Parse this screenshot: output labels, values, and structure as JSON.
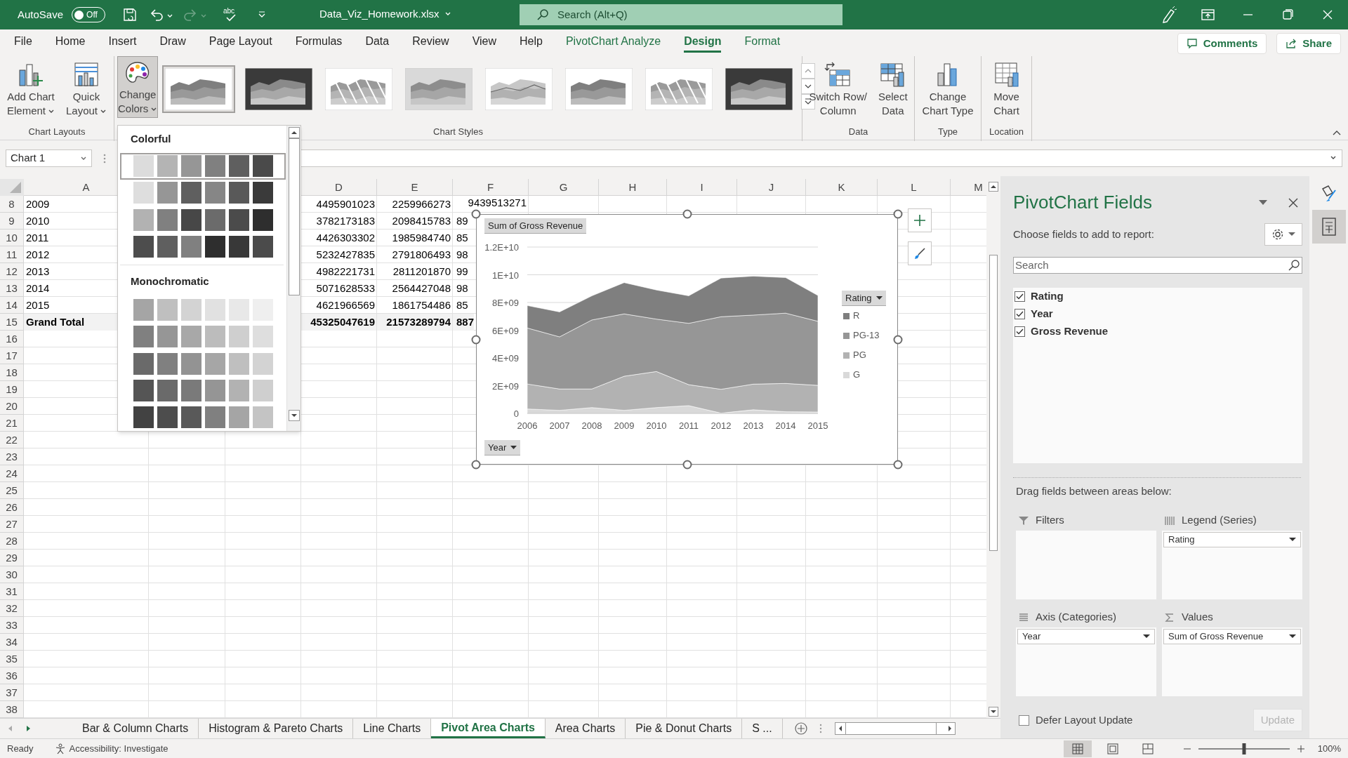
{
  "title_bar": {
    "autosave_label": "AutoSave",
    "autosave": {
      "on": false,
      "label": "Off"
    },
    "spelling_label": "abc",
    "file_name": "Data_Viz_Homework.xlsx",
    "search_placeholder": "Search (Alt+Q)"
  },
  "menu_tabs": [
    {
      "label": "File",
      "selected": false,
      "contextual": false
    },
    {
      "label": "Home",
      "selected": false,
      "contextual": false
    },
    {
      "label": "Insert",
      "selected": false,
      "contextual": false
    },
    {
      "label": "Draw",
      "selected": false,
      "contextual": false
    },
    {
      "label": "Page Layout",
      "selected": false,
      "contextual": false
    },
    {
      "label": "Formulas",
      "selected": false,
      "contextual": false
    },
    {
      "label": "Data",
      "selected": false,
      "contextual": false
    },
    {
      "label": "Review",
      "selected": false,
      "contextual": false
    },
    {
      "label": "View",
      "selected": false,
      "contextual": false
    },
    {
      "label": "Help",
      "selected": false,
      "contextual": false
    },
    {
      "label": "PivotChart Analyze",
      "selected": false,
      "contextual": true
    },
    {
      "label": "Design",
      "selected": true,
      "contextual": true
    },
    {
      "label": "Format",
      "selected": false,
      "contextual": true
    }
  ],
  "top_buttons": [
    {
      "kind": "comments",
      "label": "Comments"
    },
    {
      "kind": "share",
      "label": "Share"
    }
  ],
  "ribbon": {
    "chart_layouts": {
      "label": "Chart Layouts",
      "buttons": [
        {
          "kind": "add-element",
          "lines": [
            "Add Chart",
            "Element"
          ]
        },
        {
          "kind": "quick-layout",
          "lines": [
            "Quick",
            "Layout"
          ]
        }
      ]
    },
    "change_colors": {
      "lines": [
        "Change",
        "Colors"
      ],
      "pressed": true
    },
    "chart_styles": {
      "label": "Chart Styles",
      "styles": [
        {
          "kind": "light",
          "selected": true
        },
        {
          "kind": "dark",
          "selected": false
        },
        {
          "kind": "pattern",
          "selected": false
        },
        {
          "kind": "titled",
          "selected": false
        },
        {
          "kind": "outlined",
          "selected": false
        },
        {
          "kind": "light",
          "selected": false
        },
        {
          "kind": "pattern",
          "selected": false
        },
        {
          "kind": "dark",
          "selected": false
        }
      ]
    },
    "data": {
      "label": "Data",
      "buttons": [
        {
          "kind": "switch",
          "lines": [
            "Switch Row/",
            "Column"
          ]
        },
        {
          "kind": "select-data",
          "lines": [
            "Select",
            "Data"
          ]
        }
      ]
    },
    "type": {
      "label": "Type",
      "buttons": [
        {
          "kind": "chart-type",
          "lines": [
            "Change",
            "Chart Type"
          ]
        }
      ]
    },
    "location": {
      "label": "Location",
      "buttons": [
        {
          "kind": "move",
          "lines": [
            "Move",
            "Chart"
          ]
        }
      ]
    }
  },
  "name_box": "Chart 1",
  "color_menu": {
    "sections": [
      {
        "title": "Colorful",
        "rows": [
          {
            "selected": true,
            "swatches": [
              {
                "color": "#dcdcdc"
              },
              {
                "color": "#b4b4b4"
              },
              {
                "color": "#969696"
              },
              {
                "color": "#808080"
              },
              {
                "color": "#5f5f5f"
              },
              {
                "color": "#4a4a4a"
              }
            ]
          },
          {
            "selected": false,
            "swatches": [
              {
                "color": "#dedede"
              },
              {
                "color": "#969696"
              },
              {
                "color": "#5f5f5f"
              },
              {
                "color": "#868686"
              },
              {
                "color": "#595959"
              },
              {
                "color": "#3a3a3a"
              }
            ]
          },
          {
            "selected": false,
            "swatches": [
              {
                "color": "#b2b2b2"
              },
              {
                "color": "#808080"
              },
              {
                "color": "#474747"
              },
              {
                "color": "#6b6b6b"
              },
              {
                "color": "#4b4b4b"
              },
              {
                "color": "#2e2e2e"
              }
            ]
          },
          {
            "selected": false,
            "swatches": [
              {
                "color": "#4d4d4d"
              },
              {
                "color": "#5f5f5f"
              },
              {
                "color": "#808080"
              },
              {
                "color": "#2e2e2e"
              },
              {
                "color": "#383838"
              },
              {
                "color": "#4b4b4b"
              }
            ]
          }
        ]
      },
      {
        "title": "Monochromatic",
        "rows": [
          {
            "selected": false,
            "swatches": [
              {
                "color": "#a5a5a5"
              },
              {
                "color": "#bfbfbf"
              },
              {
                "color": "#d3d3d3"
              },
              {
                "color": "#e1e1e1"
              },
              {
                "color": "#e8e8e8"
              },
              {
                "color": "#efefef"
              }
            ]
          },
          {
            "selected": false,
            "swatches": [
              {
                "color": "#808080"
              },
              {
                "color": "#969696"
              },
              {
                "color": "#a8a8a8"
              },
              {
                "color": "#bcbcbc"
              },
              {
                "color": "#cfcfcf"
              },
              {
                "color": "#dedede"
              }
            ]
          },
          {
            "selected": false,
            "swatches": [
              {
                "color": "#6a6a6a"
              },
              {
                "color": "#808080"
              },
              {
                "color": "#939393"
              },
              {
                "color": "#a6a6a6"
              },
              {
                "color": "#bfbfbf"
              },
              {
                "color": "#d3d3d3"
              }
            ]
          },
          {
            "selected": false,
            "swatches": [
              {
                "color": "#555555"
              },
              {
                "color": "#6a6a6a"
              },
              {
                "color": "#7a7a7a"
              },
              {
                "color": "#959595"
              },
              {
                "color": "#b2b2b2"
              },
              {
                "color": "#cfcfcf"
              }
            ]
          },
          {
            "selected": false,
            "swatches": [
              {
                "color": "#424242"
              },
              {
                "color": "#4d4d4d"
              },
              {
                "color": "#595959"
              },
              {
                "color": "#808080"
              },
              {
                "color": "#a5a5a5"
              },
              {
                "color": "#c4c4c4"
              }
            ]
          }
        ]
      }
    ]
  },
  "sheet": {
    "columns": [
      "A",
      "D",
      "E",
      "F",
      "G",
      "H",
      "I",
      "J",
      "K",
      "L",
      "M"
    ],
    "rows": [
      {
        "num": "8",
        "total": false,
        "cells": [
          "2009",
          "4495901023",
          "2259966273",
          "9439513271"
        ]
      },
      {
        "num": "9",
        "total": false,
        "cells": [
          "2010",
          "3782173183",
          "2098415783",
          "89"
        ]
      },
      {
        "num": "10",
        "total": false,
        "cells": [
          "2011",
          "4426303302",
          "1985984740",
          "85"
        ]
      },
      {
        "num": "11",
        "total": false,
        "cells": [
          "2012",
          "5232427835",
          "2791806493",
          "98"
        ]
      },
      {
        "num": "12",
        "total": false,
        "cells": [
          "2013",
          "4982221731",
          "2811201870",
          "99"
        ]
      },
      {
        "num": "13",
        "total": false,
        "cells": [
          "2014",
          "5071628533",
          "2564427048",
          "98"
        ]
      },
      {
        "num": "14",
        "total": false,
        "cells": [
          "2015",
          "4621966569",
          "1861754486",
          "85"
        ]
      },
      {
        "num": "15",
        "total": true,
        "cells": [
          "Grand Total",
          "45325047619",
          "21573289794",
          "887"
        ]
      },
      {
        "num": "16"
      },
      {
        "num": "17"
      },
      {
        "num": "18"
      },
      {
        "num": "19"
      },
      {
        "num": "20"
      },
      {
        "num": "21"
      },
      {
        "num": "22"
      },
      {
        "num": "23"
      },
      {
        "num": "24"
      },
      {
        "num": "25"
      },
      {
        "num": "26"
      },
      {
        "num": "27"
      },
      {
        "num": "28"
      },
      {
        "num": "29"
      },
      {
        "num": "30"
      },
      {
        "num": "31"
      },
      {
        "num": "32"
      },
      {
        "num": "33"
      },
      {
        "num": "34"
      },
      {
        "num": "35"
      },
      {
        "num": "36"
      },
      {
        "num": "37"
      },
      {
        "num": "38"
      }
    ]
  },
  "chart": {
    "value_button": "Sum of Gross Revenue",
    "axis_button": "Year",
    "chart_data": {
      "type": "area",
      "stacked": true,
      "legend": {
        "title": "Rating"
      },
      "categories": [
        "2006",
        "2007",
        "2008",
        "2009",
        "2010",
        "2011",
        "2012",
        "2013",
        "2014",
        "2015"
      ],
      "ylim": [
        0,
        12000000000
      ],
      "yticks": [
        {
          "value": 0,
          "label": "0"
        },
        {
          "value": 2000000000,
          "label": "2E+09"
        },
        {
          "value": 4000000000,
          "label": "4E+09"
        },
        {
          "value": 6000000000,
          "label": "6E+09"
        },
        {
          "value": 8000000000,
          "label": "8E+09"
        },
        {
          "value": 10000000000,
          "label": "1E+10"
        },
        {
          "value": 12000000000,
          "label": "1.2E+10"
        }
      ],
      "series": [
        {
          "name": "G",
          "color": "#d9d9d9",
          "values": [
            320000000,
            220000000,
            420000000,
            220000000,
            420000000,
            560000000,
            20000000,
            260000000,
            120000000,
            100000000
          ]
        },
        {
          "name": "PG",
          "color": "#b2b2b2",
          "values": [
            1800000000,
            1540000000,
            1340000000,
            2460000000,
            2600000000,
            1510000000,
            1720000000,
            1850000000,
            2040000000,
            1920000000
          ]
        },
        {
          "name": "PG-13",
          "color": "#969696",
          "values": [
            4040000000,
            3760000000,
            4980000000,
            4495901023,
            3782173183,
            4426303302,
            5232427835,
            4982221731,
            5071628533,
            4621966569
          ]
        },
        {
          "name": "R",
          "color": "#7f7f7f",
          "values": [
            1620000000,
            1800000000,
            1740000000,
            2259966273,
            2098415783,
            1985984740,
            2791806493,
            2811201870,
            2564427048,
            1861754486
          ]
        }
      ]
    }
  },
  "pane": {
    "title": "PivotChart Fields",
    "subtitle": "Choose fields to add to report:",
    "search_placeholder": "Search",
    "fields": [
      {
        "label": "Rating",
        "checked": true
      },
      {
        "label": "Year",
        "checked": true
      },
      {
        "label": "Gross Revenue",
        "checked": true
      }
    ],
    "drag_hint": "Drag fields between areas below:",
    "areas": [
      {
        "kind": "filters",
        "title": "Filters"
      },
      {
        "kind": "legend",
        "title": "Legend (Series)",
        "items": [
          "Rating"
        ]
      },
      {
        "kind": "axis",
        "title": "Axis (Categories)",
        "items": [
          "Year"
        ]
      },
      {
        "kind": "values",
        "title": "Values",
        "items": [
          "Sum of Gross Revenue"
        ]
      }
    ],
    "defer": {
      "label": "Defer Layout Update",
      "checked": false
    },
    "update": {
      "label": "Update",
      "disabled": true
    }
  },
  "sheet_tabs": [
    {
      "label": "Bar & Column Charts",
      "selected": false
    },
    {
      "label": "Histogram & Pareto Charts",
      "selected": false
    },
    {
      "label": "Line Charts",
      "selected": false
    },
    {
      "label": "Pivot Area Charts",
      "selected": true
    },
    {
      "label": "Area Charts",
      "selected": false
    },
    {
      "label": "Pie & Donut Charts",
      "selected": false
    },
    {
      "label": "S ...",
      "selected": false
    }
  ],
  "status_bar": {
    "ready": "Ready",
    "accessibility": "Accessibility: Investigate",
    "zoom": {
      "level": 0.5,
      "label": "100%"
    }
  }
}
